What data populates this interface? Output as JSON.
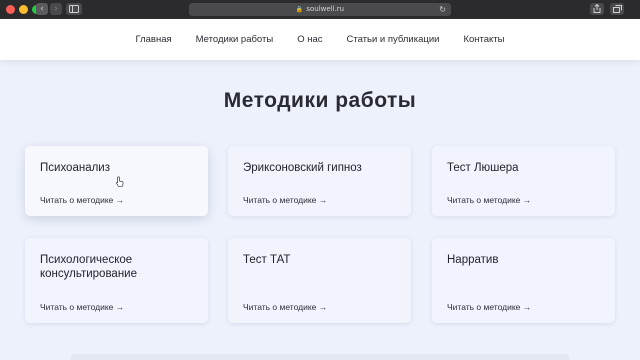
{
  "browser": {
    "url": "soulwell.ru",
    "back_icon": "‹",
    "forward_icon": "›",
    "reload_icon": "↻"
  },
  "nav": {
    "items": [
      {
        "label": "Главная"
      },
      {
        "label": "Методики работы"
      },
      {
        "label": "О нас"
      },
      {
        "label": "Статьи и публикации"
      },
      {
        "label": "Контакты"
      }
    ]
  },
  "section": {
    "title": "Методики работы"
  },
  "cards": [
    {
      "title": "Психоанализ",
      "link": "Читать о методике →"
    },
    {
      "title": "Эриксоновский гипноз",
      "link": "Читать о методике →"
    },
    {
      "title": "Тест Люшера",
      "link": "Читать о методике →"
    },
    {
      "title": "Психологическое консультирование",
      "link": "Читать о методике →"
    },
    {
      "title": "Тест ТАТ",
      "link": "Читать о методике →"
    },
    {
      "title": "Нарратив",
      "link": "Читать о методике →"
    }
  ],
  "colors": {
    "page_background": "#edf1fb",
    "card_background": "#f1f4fc",
    "header_background": "#ffffff",
    "text": "#2a2a33"
  }
}
